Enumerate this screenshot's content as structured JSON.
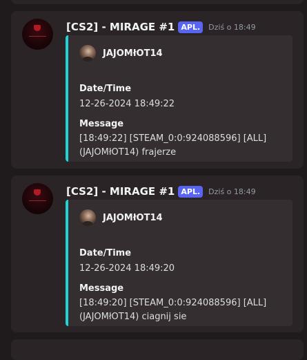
{
  "messages": [
    {
      "author": "[CS2] - MIRAGE #1",
      "badge": "APL.",
      "timestamp": "Dziś o 18:49",
      "embed": {
        "author": "JAJOMłOT14",
        "fields": [
          {
            "name": "Date/Time",
            "value": "12-26-2024 18:49:22"
          },
          {
            "name": "Message",
            "value": "[18:49:22] [STEAM_0:0:924088596] [ALL] (JAJOMłOT14) frajerze"
          }
        ],
        "accent_color": "#1fd3d6"
      }
    },
    {
      "author": "[CS2] - MIRAGE #1",
      "badge": "APL.",
      "timestamp": "Dziś o 18:49",
      "embed": {
        "author": "JAJOMłOT14",
        "fields": [
          {
            "name": "Date/Time",
            "value": "12-26-2024 18:49:20"
          },
          {
            "name": "Message",
            "value": "[18:49:20] [STEAM_0:0:924088596] [ALL] (JAJOMłOT14) ciagnij sie"
          }
        ],
        "accent_color": "#1fd3d6"
      }
    }
  ],
  "colors": {
    "background": "#1f1a1c",
    "message_bg": "#2a2426",
    "embed_bg": "#352e31",
    "badge": "#5865f2"
  }
}
